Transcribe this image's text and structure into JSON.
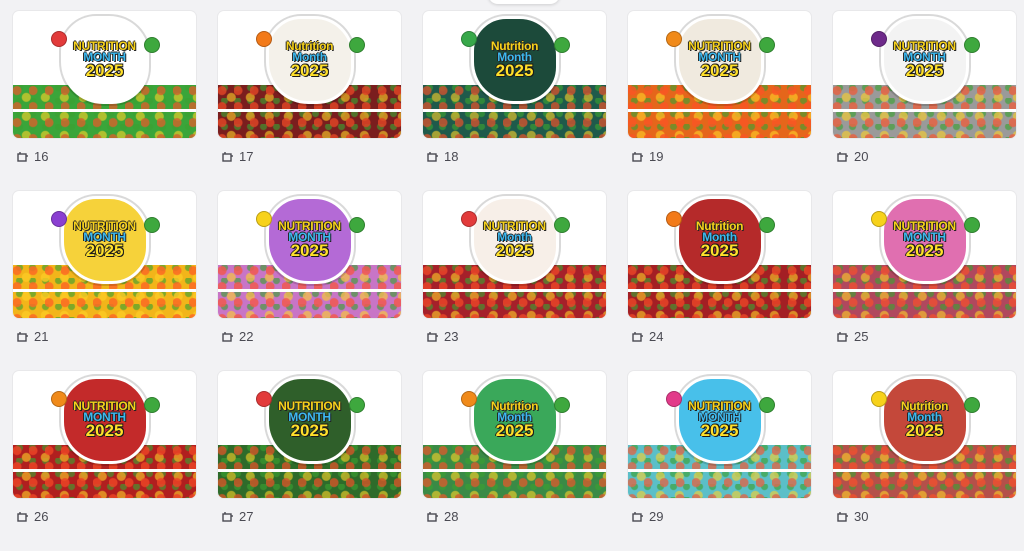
{
  "grid": {
    "items": [
      {
        "number": "16",
        "line1": "NUTRITION",
        "line2": "MONTH",
        "year": "2025",
        "band": "#3aa53a",
        "badge": "#ffffff",
        "accent": "#e23b3b"
      },
      {
        "number": "17",
        "line1": "Nutrition",
        "line2": "Month",
        "year": "2025",
        "band": "#7a1e1e",
        "badge": "#f4f1ea",
        "accent": "#f27a1a"
      },
      {
        "number": "18",
        "line1": "Nutrition",
        "line2": "Month",
        "year": "2025",
        "band": "#1f5a4b",
        "badge": "#1c4a3a",
        "accent": "#37a84a"
      },
      {
        "number": "19",
        "line1": "NUTRITION",
        "line2": "MONTH",
        "year": "2025",
        "band": "#e5661b",
        "badge": "#f0eadf",
        "accent": "#f08a1a"
      },
      {
        "number": "20",
        "line1": "NUTRITION",
        "line2": "MONTH",
        "year": "2025",
        "band": "#9a9a9a",
        "badge": "#f3f3f3",
        "accent": "#6e2a8a"
      },
      {
        "number": "21",
        "line1": "NUTRITION",
        "line2": "MONTH",
        "year": "2025",
        "band": "#f2b51a",
        "badge": "#f6d23a",
        "accent": "#8a3fd1"
      },
      {
        "number": "22",
        "line1": "NUTRITION",
        "line2": "MONTH",
        "year": "2025",
        "band": "#c875c6",
        "badge": "#b46ad6",
        "accent": "#f7d21b"
      },
      {
        "number": "23",
        "line1": "NUTRITION",
        "line2": "Month",
        "year": "2025",
        "band": "#a5202a",
        "badge": "#f7efe8",
        "accent": "#e23b3b"
      },
      {
        "number": "24",
        "line1": "Nutrition",
        "line2": "Month",
        "year": "2025",
        "band": "#a31f24",
        "badge": "#b52a2a",
        "accent": "#f27a1a"
      },
      {
        "number": "25",
        "line1": "NUTRITION",
        "line2": "MONTH",
        "year": "2025",
        "band": "#b0485e",
        "badge": "#e06fb0",
        "accent": "#f7d21b"
      },
      {
        "number": "26",
        "line1": "NUTRITION",
        "line2": "MONTH",
        "year": "2025",
        "band": "#b01f1f",
        "badge": "#c32a2a",
        "accent": "#f08a1a"
      },
      {
        "number": "27",
        "line1": "NUTRITION",
        "line2": "MONTH",
        "year": "2025",
        "band": "#2e6b2a",
        "badge": "#2f5f2a",
        "accent": "#e23b3b"
      },
      {
        "number": "28",
        "line1": "Nutrition",
        "line2": "Month",
        "year": "2025",
        "band": "#3a8a46",
        "badge": "#3aa85a",
        "accent": "#f08a1a"
      },
      {
        "number": "29",
        "line1": "NUTRITION",
        "line2": "MONTH",
        "year": "2025",
        "band": "#5bbfc8",
        "badge": "#48c0ea",
        "accent": "#e23b8a"
      },
      {
        "number": "30",
        "line1": "Nutrition",
        "line2": "Month",
        "year": "2025",
        "band": "#b4504a",
        "badge": "#c4483a",
        "accent": "#f7d21b"
      }
    ]
  }
}
